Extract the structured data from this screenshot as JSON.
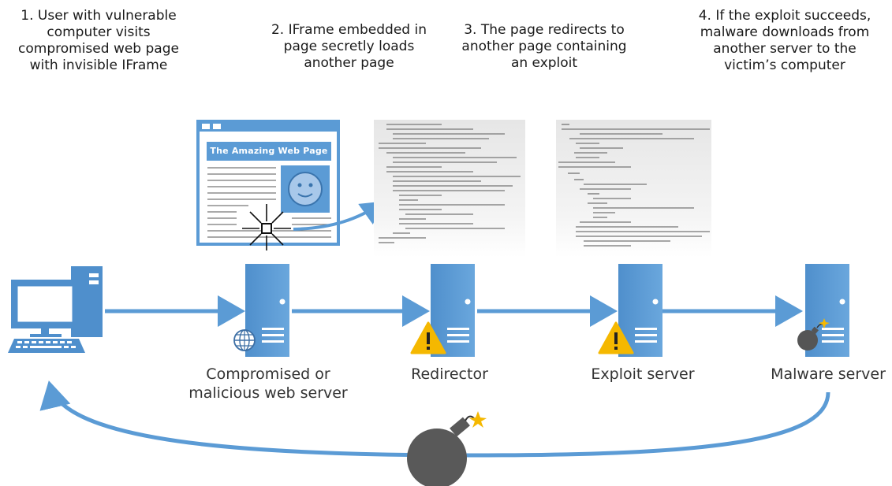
{
  "steps": [
    "1. User with vulnerable\ncomputer visits\ncompromised web page\nwith invisible IFrame",
    "2. IFrame embedded in\npage secretly loads\nanother page",
    "3. The page redirects to\nanother page containing\nan exploit",
    "4. If the exploit succeeds,\nmalware downloads from\nanother server to the\nvictim’s computer"
  ],
  "webpage_title": "The Amazing Web Page",
  "servers": [
    {
      "label": "Compromised or\nmalicious web server",
      "badge": "globe-icon"
    },
    {
      "label": "Redirector",
      "badge": "warning-icon"
    },
    {
      "label": "Exploit server",
      "badge": "warning-icon"
    },
    {
      "label": "Malware server",
      "badge": "bomb-icon"
    }
  ],
  "colors": {
    "blue": "#5b9bd5",
    "arrow": "#5b9bd5",
    "warning": "#f5b800",
    "bomb": "#555555"
  }
}
